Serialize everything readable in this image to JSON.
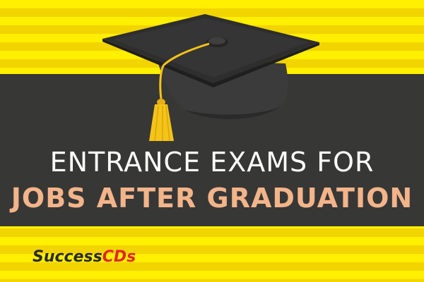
{
  "banner": {
    "title_line1": "ENTRANCE EXAMS FOR",
    "title_line2": "JOBS AFTER GRADUATION"
  },
  "brand": {
    "name_part1": "Success",
    "name_part2": "CDs"
  },
  "colors": {
    "stripe_light": "#ffef00",
    "stripe_dark": "#f2d400",
    "band": "#373736",
    "title_line1": "#ffffff",
    "title_line2": "#f3b48a",
    "brand_text": "#2a2a2a",
    "brand_accent": "#e0262b",
    "tassel": "#f5c419"
  },
  "icons": {
    "main": "graduation-cap-icon"
  }
}
